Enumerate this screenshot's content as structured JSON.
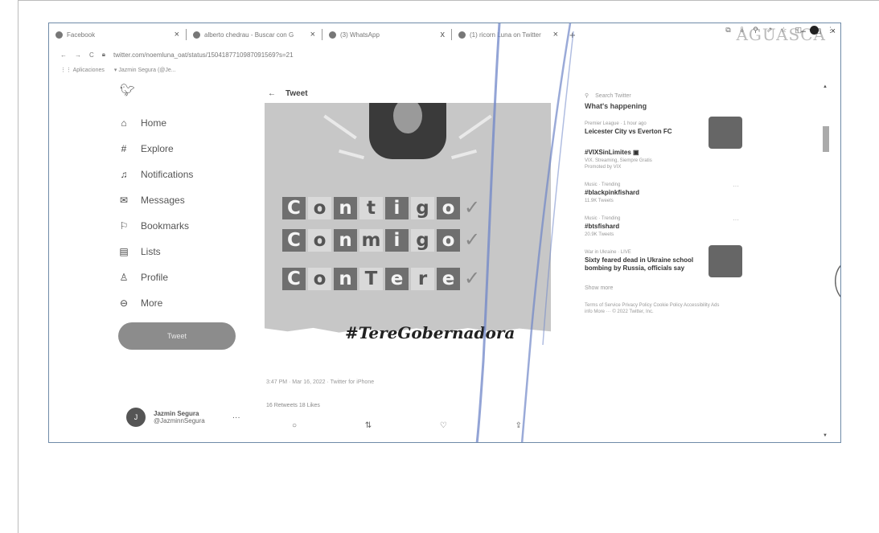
{
  "browser": {
    "tabs": [
      {
        "label": "Facebook",
        "close": "×"
      },
      {
        "label": "alberto chedrau - Buscar con G",
        "close": "×"
      },
      {
        "label": "(3) WhatsApp",
        "close": "x"
      },
      {
        "label": "(1) ricorn Luna on Twitter",
        "close": "×"
      }
    ],
    "new_tab": "+",
    "watermark": "AGUASCA",
    "window_controls": [
      "–",
      "□",
      "×"
    ],
    "nav_back": "←",
    "nav_forward": "→",
    "nav_reload": "C",
    "url": "twitter.com/noemluna_oat/status/1504187710987091569?s=21",
    "bookmarks": [
      "Aplicaciones",
      "Jazmin Segura (@Je..."
    ]
  },
  "twitter": {
    "logo": "🐦",
    "nav": [
      {
        "icon": "home-icon",
        "glyph": "⌂",
        "label": "Home"
      },
      {
        "icon": "hashtag-icon",
        "glyph": "#",
        "label": "Explore"
      },
      {
        "icon": "bell-icon",
        "glyph": "♫",
        "label": "Notifications"
      },
      {
        "icon": "envelope-icon",
        "glyph": "✉",
        "label": "Messages"
      },
      {
        "icon": "bookmark-icon",
        "glyph": "⚐",
        "label": "Bookmarks"
      },
      {
        "icon": "list-icon",
        "glyph": "▤",
        "label": "Lists"
      },
      {
        "icon": "person-icon",
        "glyph": "♙",
        "label": "Profile"
      },
      {
        "icon": "more-circle-icon",
        "glyph": "⊖",
        "label": "More"
      }
    ],
    "tweet_button": "Tweet",
    "user": {
      "initial": "J",
      "name": "Jazmin Segura",
      "handle": "@JazminnSegura",
      "more": "···"
    }
  },
  "tweet": {
    "back": "←",
    "header": "Tweet",
    "image": {
      "rows": [
        {
          "tiles": [
            "C",
            "o",
            "n",
            "t",
            "i",
            "g",
            "o"
          ],
          "check": "✓"
        },
        {
          "tiles": [
            "C",
            "o",
            "n",
            "m",
            "i",
            "g",
            "o"
          ],
          "check": "✓"
        },
        {
          "tiles": [
            "C",
            "o",
            "n",
            "T",
            "e",
            "r",
            "e"
          ],
          "check": "✓"
        }
      ],
      "hashtag": "#TereGobernadora"
    },
    "meta": "3:47 PM · Mar 16, 2022 · Twitter for iPhone",
    "stats": "16 Retweets   18 Likes",
    "actions": [
      {
        "name": "reply-icon",
        "glyph": "○"
      },
      {
        "name": "retweet-icon",
        "glyph": "⇅"
      },
      {
        "name": "like-icon",
        "glyph": "♡"
      },
      {
        "name": "share-icon",
        "glyph": "⇪"
      }
    ]
  },
  "sidebar": {
    "search_icon": "⚲",
    "search_placeholder": "Search Twitter",
    "heading": "What's happening",
    "trends": [
      {
        "meta": "Premier League · 1 hour ago",
        "title": "Leicester City vs Everton FC",
        "sub": "",
        "has_thumb": true,
        "dots": ""
      },
      {
        "meta": "",
        "title": "#VIXSinLimites ▣",
        "sub": "VIX. Streaming, Siempre Gratis",
        "sub2": "Promoted by VIX",
        "has_thumb": false,
        "dots": ""
      },
      {
        "meta": "Music · Trending",
        "title": "#blackpinkfishard",
        "sub": "11.9K Tweets",
        "has_thumb": false,
        "dots": "···"
      },
      {
        "meta": "Music · Trending",
        "title": "#btsfishard",
        "sub": "20.9K Tweets",
        "has_thumb": false,
        "dots": "···"
      },
      {
        "meta": "War in Ukraine · LIVE",
        "title": "Sixty feared dead in Ukraine school bombing by Russia, officials say",
        "sub": "",
        "has_thumb": true,
        "dots": ""
      }
    ],
    "show_more": "Show more",
    "footer": "Terms of Service  Privacy Policy  Cookie Policy  Accessibility  Ads info  More ···  © 2022 Twitter, Inc."
  },
  "scrollbar": {
    "up": "▲",
    "down": "▼"
  }
}
